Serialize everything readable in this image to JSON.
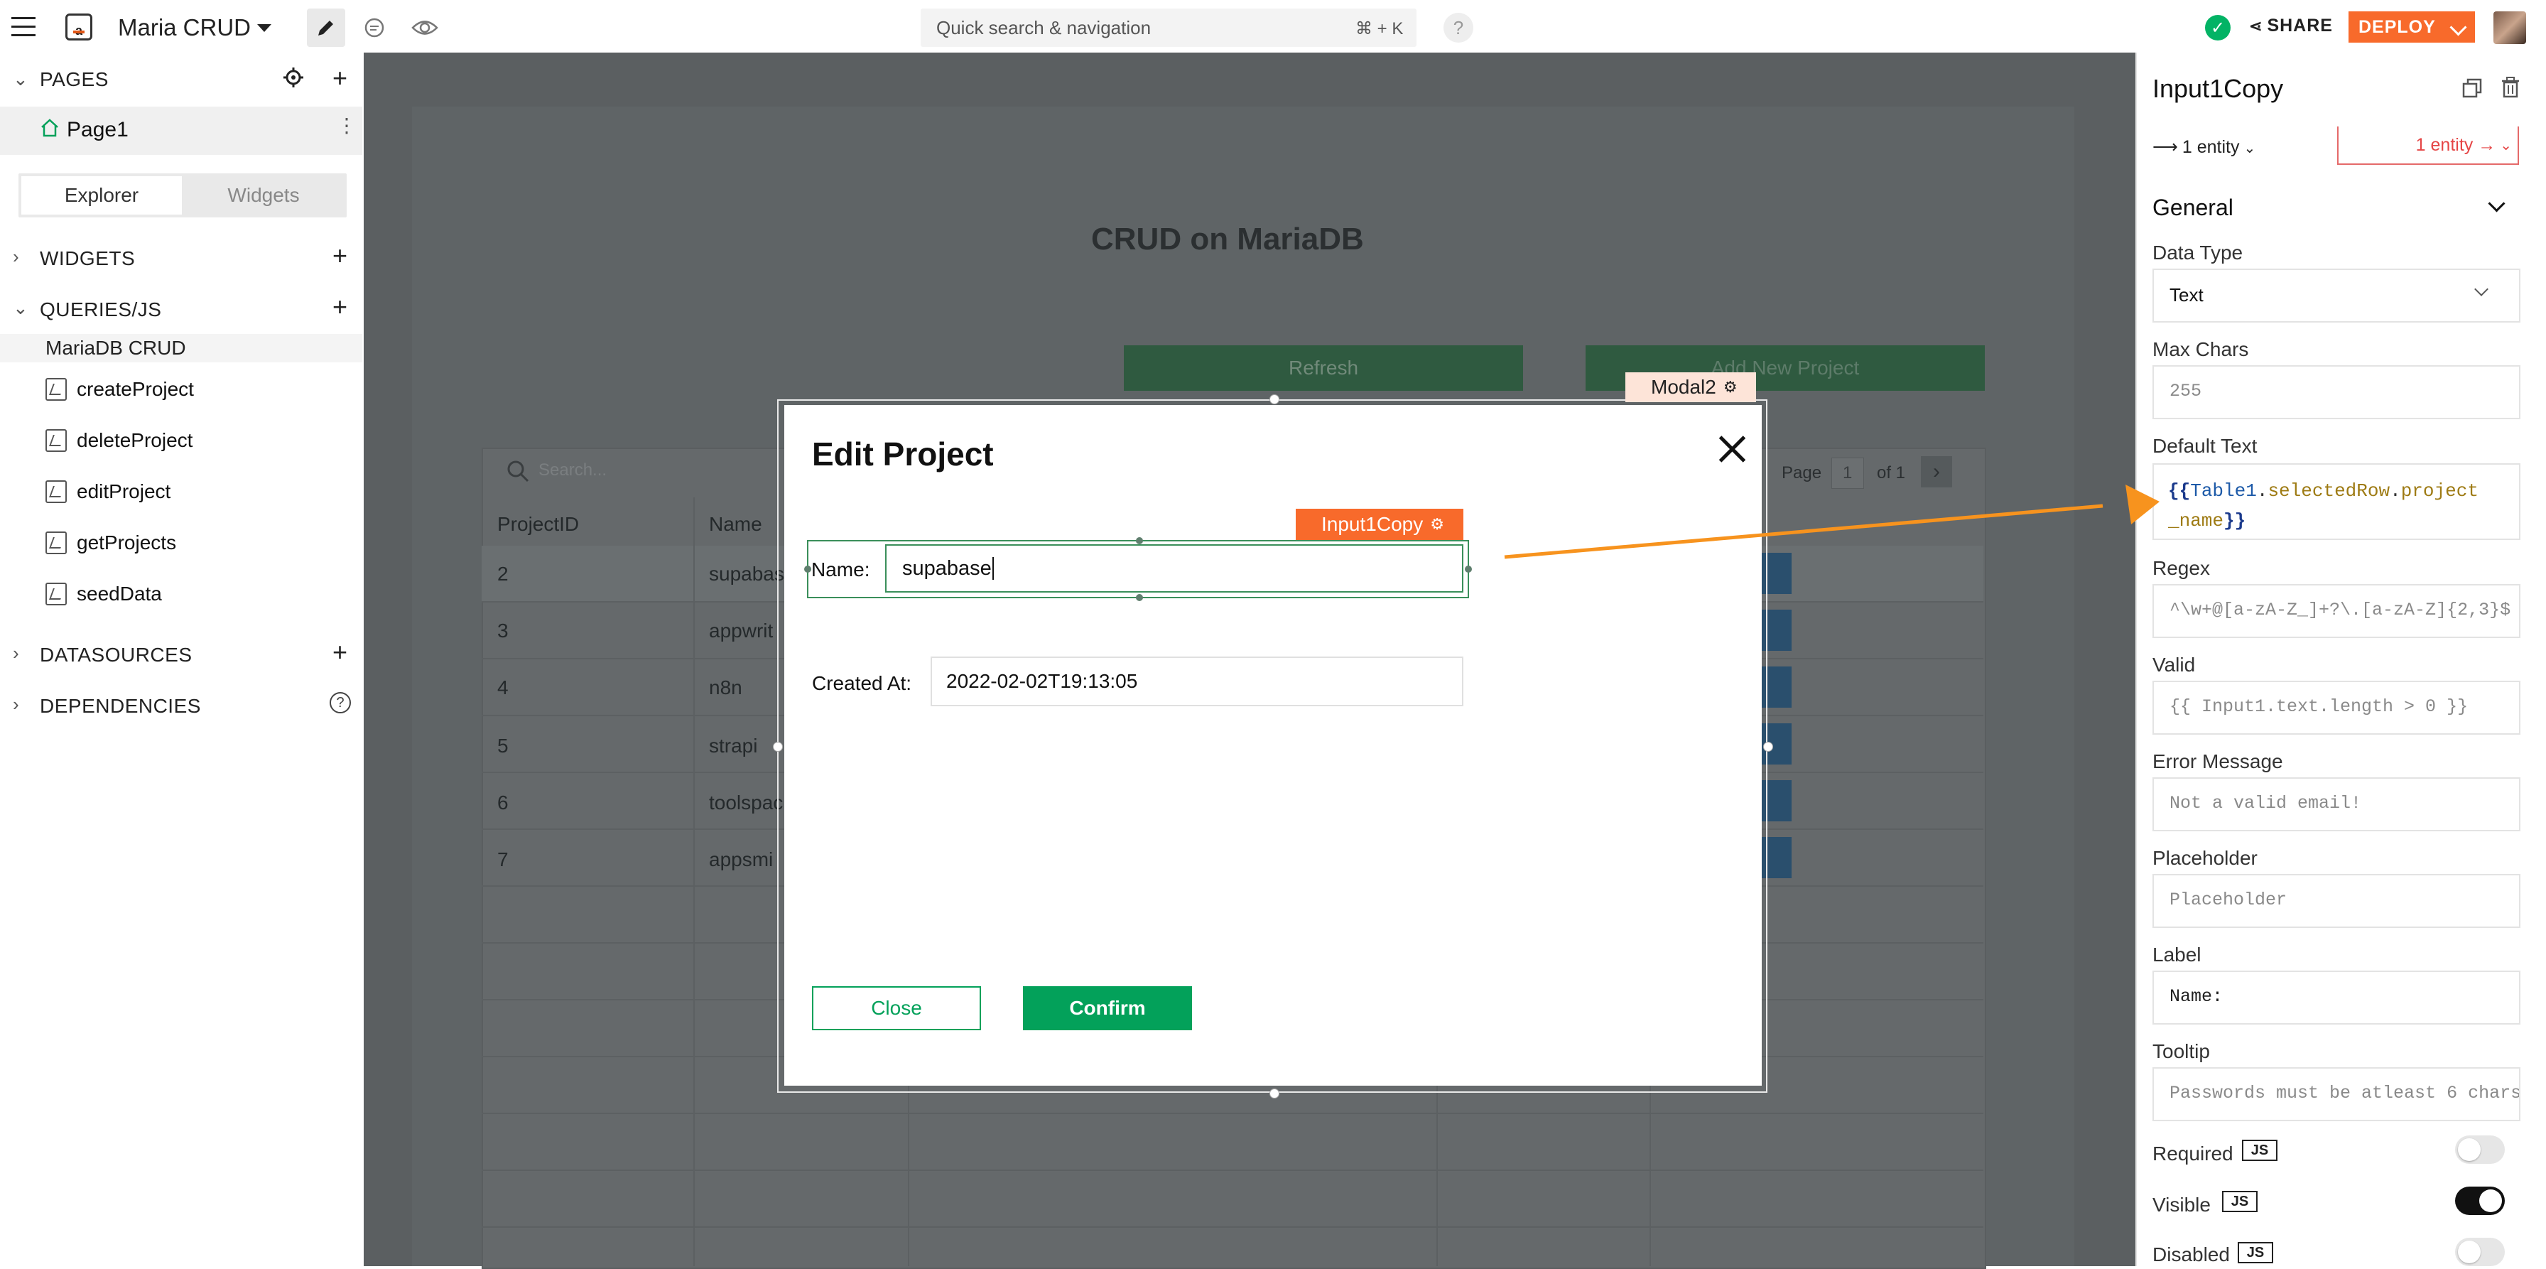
{
  "app": {
    "name": "Maria CRUD"
  },
  "search": {
    "placeholder": "Quick search & navigation",
    "shortcut": "⌘ + K"
  },
  "header": {
    "help": "?",
    "share": "SHARE",
    "deploy": "DEPLOY"
  },
  "sidebar": {
    "pages_heading": "PAGES",
    "page_name": "Page1",
    "tab_explorer": "Explorer",
    "tab_widgets": "Widgets",
    "widgets_heading": "WIDGETS",
    "queries_heading": "QUERIES/JS",
    "query_group": "MariaDB CRUD",
    "queries": [
      "createProject",
      "deleteProject",
      "editProject",
      "getProjects",
      "seedData"
    ],
    "datasources_heading": "DATASOURCES",
    "dependencies_heading": "DEPENDENCIES"
  },
  "canvas": {
    "heading": "CRUD on MariaDB",
    "refresh": "Refresh",
    "add_new": "Add New Project",
    "table_search": "Search...",
    "pager_page": "Page",
    "pager_current": "1",
    "pager_of": "of 1",
    "columns": [
      "ProjectID",
      "Name"
    ],
    "rows": [
      {
        "id": "2",
        "name": "supabas"
      },
      {
        "id": "3",
        "name": "appwrit"
      },
      {
        "id": "4",
        "name": "n8n"
      },
      {
        "id": "5",
        "name": "strapi"
      },
      {
        "id": "6",
        "name": "toolspac"
      },
      {
        "id": "7",
        "name": "appsmi"
      }
    ]
  },
  "modal": {
    "tag": "Modal2",
    "title": "Edit Project",
    "input_tag": "Input1Copy",
    "name_label": "Name:",
    "name_value": "supabase",
    "created_label": "Created At:",
    "created_value": "2022-02-02T19:13:05",
    "close": "Close",
    "confirm": "Confirm"
  },
  "pane": {
    "title": "Input1Copy",
    "entity_in": "1 entity",
    "entity_out": "1 entity →",
    "section": "General",
    "data_type_label": "Data Type",
    "data_type_value": "Text",
    "max_chars_label": "Max Chars",
    "max_chars_value": "255",
    "default_text_label": "Default Text",
    "default_tokens": {
      "open": "{{",
      "obj": "Table1",
      "dot1": ".",
      "prop1": "selectedRow",
      "dot2": ".",
      "prop2a": "project",
      "prop2b": "_name",
      "close": "}}"
    },
    "regex_label": "Regex",
    "regex_value": "^\\w+@[a-zA-Z_]+?\\.[a-zA-Z]{2,3}$",
    "valid_label": "Valid",
    "valid_value": "{{ Input1.text.length > 0 }}",
    "error_label": "Error Message",
    "error_value": "Not a valid email!",
    "placeholder_label": "Placeholder",
    "placeholder_value": "Placeholder",
    "label_label": "Label",
    "label_value": "Name:",
    "tooltip_label": "Tooltip",
    "tooltip_value": "Passwords must be atleast 6 chars",
    "js_badge": "JS",
    "toggles": [
      {
        "label": "Required",
        "on": false
      },
      {
        "label": "Visible",
        "on": true
      },
      {
        "label": "Disabled",
        "on": false
      }
    ]
  },
  "colors": {
    "accent": "#f86a2b",
    "success": "#03a15a",
    "canvas_overlay": "#5b5f61",
    "arrow": "#f7931e"
  }
}
